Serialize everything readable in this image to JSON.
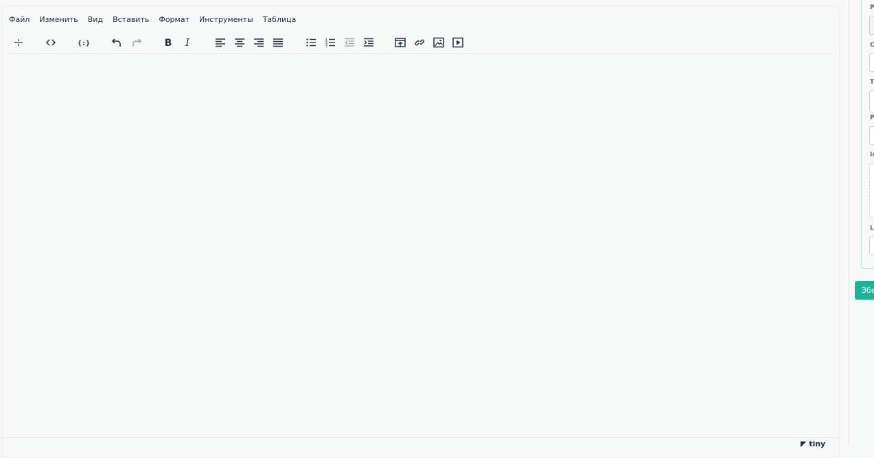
{
  "menubar": {
    "items": [
      "Файл",
      "Изменить",
      "Вид",
      "Вставить",
      "Формат",
      "Инструменты",
      "Таблица"
    ]
  },
  "toolbar": {
    "buttons": [
      {
        "icon": "hr-icon"
      },
      {
        "icon": "code-icon"
      },
      {
        "icon": "template-icon"
      },
      {
        "icon": "undo-icon"
      },
      {
        "icon": "redo-icon",
        "disabled": true
      },
      {
        "icon": "bold-icon"
      },
      {
        "icon": "italic-icon"
      },
      {
        "icon": "align-left-icon"
      },
      {
        "icon": "align-center-icon"
      },
      {
        "icon": "align-right-icon"
      },
      {
        "icon": "align-justify-icon"
      },
      {
        "icon": "bullet-list-icon"
      },
      {
        "icon": "numbered-list-icon"
      },
      {
        "icon": "outdent-icon",
        "disabled": true
      },
      {
        "icon": "indent-icon"
      },
      {
        "icon": "upload-icon"
      },
      {
        "icon": "link-icon"
      },
      {
        "icon": "image-icon"
      },
      {
        "icon": "media-icon"
      }
    ]
  },
  "status": {
    "brand": "tiny"
  },
  "right_panel": {
    "labels": [
      "Р",
      "С",
      "Т",
      "Р",
      "In",
      "L"
    ],
    "save_label": "Збе",
    "accent_color": "#1fb395"
  }
}
